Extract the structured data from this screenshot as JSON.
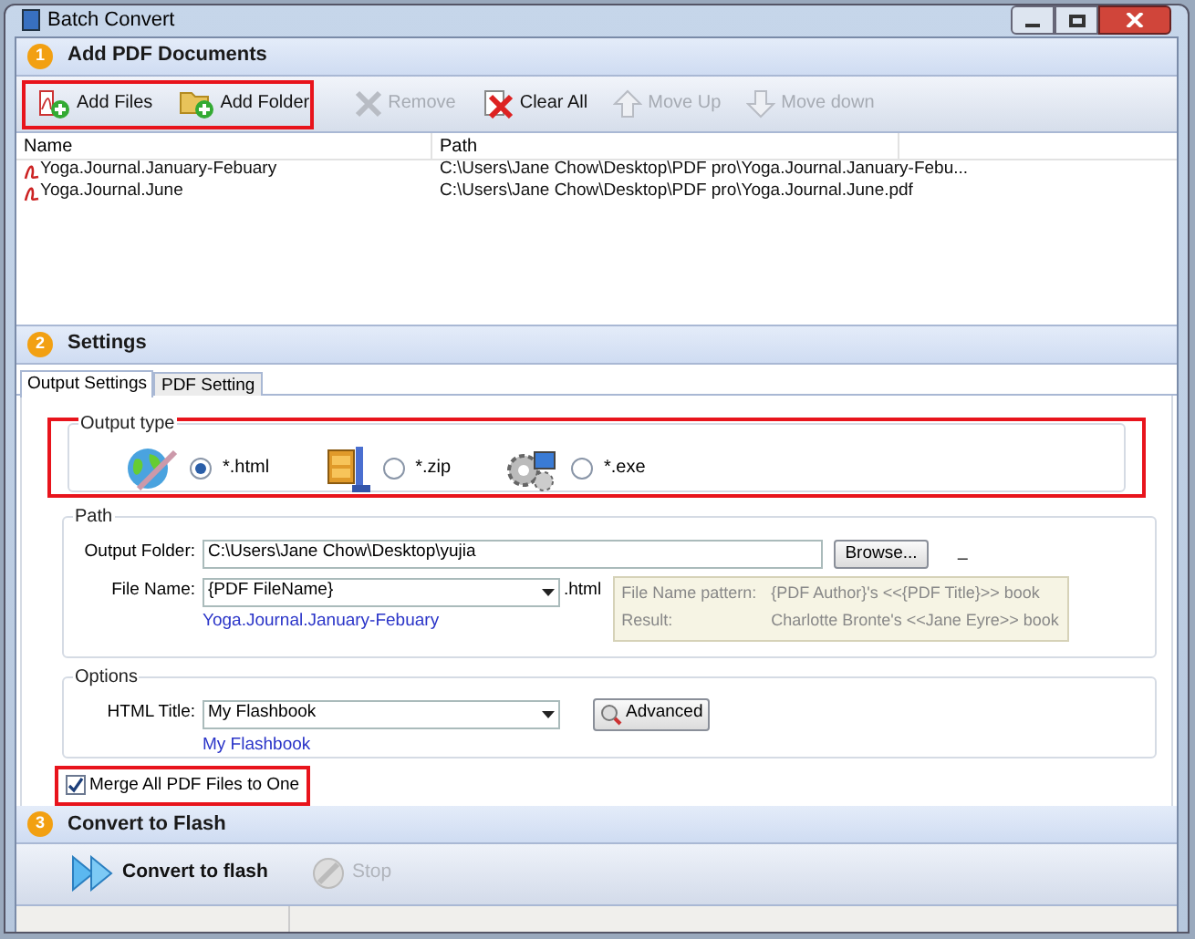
{
  "window": {
    "title": "Batch Convert"
  },
  "add_section": {
    "number": "1",
    "title": "Add PDF Documents",
    "toolbar_highlighted": true,
    "toolbar": [
      {
        "label": "Add Files",
        "disabled": false
      },
      {
        "label": "Add Folder",
        "disabled": false
      },
      {
        "label": "Remove",
        "disabled": true
      },
      {
        "label": "Clear All",
        "disabled": false
      },
      {
        "label": "Move Up",
        "disabled": true
      },
      {
        "label": "Move down",
        "disabled": true
      }
    ],
    "table": {
      "columns": [
        "Name",
        "Path"
      ],
      "rows": [
        {
          "name": "Yoga.Journal.January-Febuary",
          "path": "C:\\Users\\Jane Chow\\Desktop\\PDF pro\\Yoga.Journal.January-Febu..."
        },
        {
          "name": "Yoga.Journal.June",
          "path": "C:\\Users\\Jane Chow\\Desktop\\PDF pro\\Yoga.Journal.June.pdf"
        }
      ]
    }
  },
  "settings_section": {
    "number": "2",
    "title": "Settings",
    "tabs": [
      {
        "label": "Output Settings",
        "selected": true
      },
      {
        "label": "PDF Setting",
        "selected": false
      }
    ],
    "output_type": {
      "title": "Output type",
      "highlighted": true,
      "options": [
        {
          "label": "*.html",
          "selected": true
        },
        {
          "label": "*.zip",
          "selected": false
        },
        {
          "label": "*.exe",
          "selected": false
        }
      ]
    },
    "path": {
      "title": "Path",
      "output_folder_label": "Output Folder:",
      "output_folder": "C:\\Users\\Jane Chow\\Desktop\\yujia",
      "browse": "Browse...",
      "dash": "_",
      "file_name_label": "File Name:",
      "file_name": "{PDF FileName}",
      "extension": ".html",
      "file_name_preview": "Yoga.Journal.January-Febuary",
      "pattern": {
        "label": "File Name pattern:",
        "value": "{PDF Author}'s <<{PDF Title}>> book",
        "result_label": "Result:",
        "result": "Charlotte Bronte's <<Jane Eyre>> book"
      }
    },
    "options": {
      "title": "Options",
      "html_title_label": "HTML Title:",
      "html_title": "My Flashbook",
      "advanced": "Advanced",
      "html_title_preview": "My Flashbook"
    },
    "merge": {
      "label": "Merge All PDF Files to One",
      "checked": true,
      "highlighted": true
    }
  },
  "convert_section": {
    "number": "3",
    "title": "Convert to Flash",
    "toolbar": [
      {
        "label": "Convert to flash",
        "disabled": false
      },
      {
        "label": "Stop",
        "disabled": true
      }
    ]
  }
}
